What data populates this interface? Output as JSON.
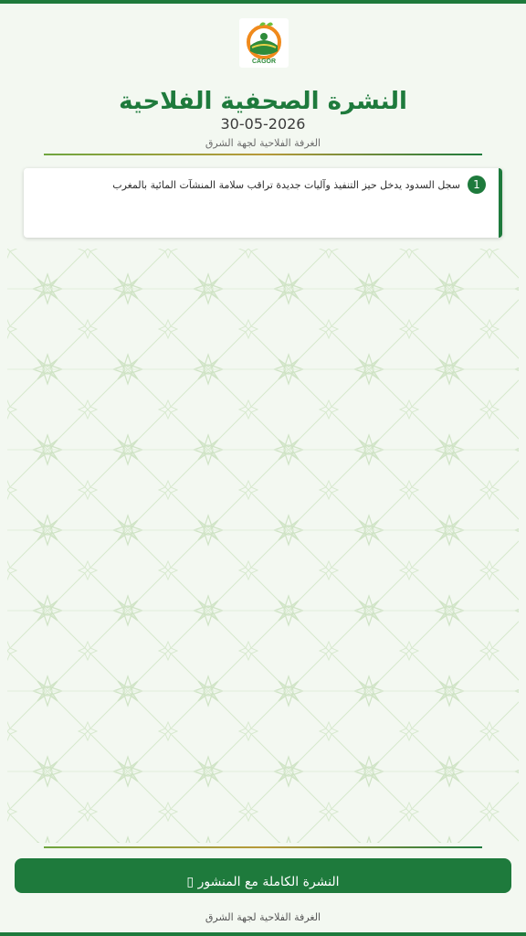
{
  "header": {
    "logo_text": "CAGOR",
    "title": "النشرة الصحفية الفلاحية",
    "date": "30-05-2026",
    "subtitle": "الغرفة الفلاحية لجهة الشرق"
  },
  "news": [
    {
      "number": "1",
      "text": "سجل السدود يدخل حيز التنفيذ وآليات جديدة تراقب سلامة المنشآت المائية بالمغرب"
    }
  ],
  "button": {
    "label": "النشرة الكاملة مع المنشور ▯"
  },
  "footer": {
    "text": "الغرفة الفلاحية لجهة الشرق"
  },
  "colors": {
    "accent": "#1e7a3c",
    "background": "#f3f8f1",
    "pattern": "#cfe3c5"
  }
}
